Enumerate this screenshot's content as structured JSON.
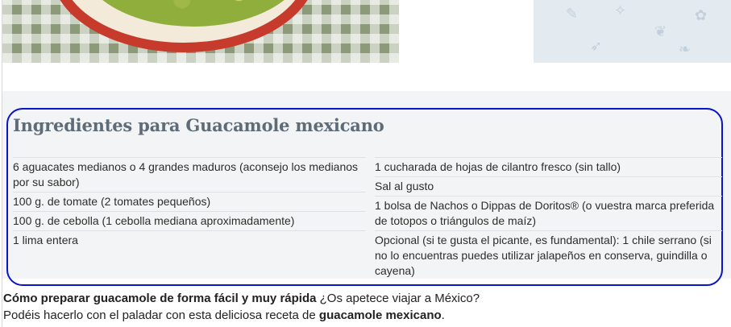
{
  "icons": [
    "avocado-bowl-photo",
    "food-doodle-pattern"
  ],
  "recipe": {
    "title": "Ingredientes para Guacamole mexicano",
    "ingredients_left": [
      "6 aguacates medianos o 4 grandes maduros (aconsejo los medianos por su sabor)",
      "100 g. de tomate (2 tomates pequeños)",
      "100 g. de cebolla (1 cebolla mediana aproximadamente)",
      "1 lima entera"
    ],
    "ingredients_right": [
      "1 cucharada de hojas de cilantro fresco (sin tallo)",
      "Sal al gusto",
      "1 bolsa de Nachos o Dippas de Doritos® (o vuestra marca preferida de totopos o triángulos de maíz)",
      "Opcional (si te gusta el picante, es fundamental): 1 chile serrano (si no lo encuentras puedes utilizar jalapeños en conserva, guindilla o cayena)"
    ]
  },
  "intro": {
    "line1_bold": "Cómo preparar guacamole de forma fácil y muy rápida",
    "line1_rest": " ¿Os apetece viajar a México?",
    "line2_start": "Podéis hacerlo con el paladar con esta deliciosa receta de ",
    "line2_bold": "guacamole mexicano",
    "line2_end": "."
  },
  "colors": {
    "highlight_border": "#0a14c8",
    "title": "#5f6b76",
    "band": "#f2f4f5"
  }
}
